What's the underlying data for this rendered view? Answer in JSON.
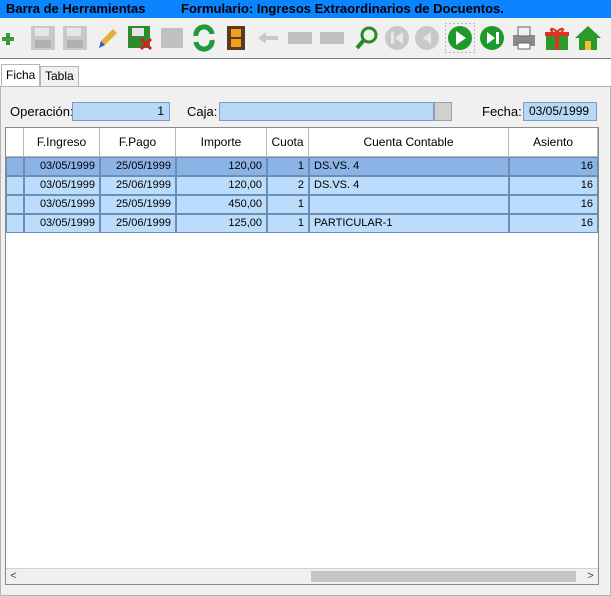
{
  "title": {
    "toolbar_label": "Barra de Herramientas",
    "form_label": "Formulario: Ingresos Extraordinarios de Docuentos."
  },
  "toolbar": {
    "buttons": [
      "add-icon",
      "save-icon",
      "save-as-icon",
      "edit-icon",
      "save-delete-icon",
      "undo-icon",
      "refresh-icon",
      "film-icon",
      "back-arrow-icon",
      "minus-icon",
      "equal-icon",
      "search-icon",
      "first-icon",
      "prev-icon",
      "next-icon",
      "last-icon",
      "print-icon",
      "gift-icon",
      "home-icon"
    ]
  },
  "tabs": [
    {
      "label": "Ficha",
      "active": true
    },
    {
      "label": "Tabla",
      "active": false
    }
  ],
  "form": {
    "operacion_label": "Operación:",
    "operacion_value": "1",
    "caja_label": "Caja:",
    "caja_value": "",
    "fecha_label": "Fecha:",
    "fecha_value": "03/05/1999"
  },
  "table": {
    "columns": [
      "F.Ingreso",
      "F.Pago",
      "Importe",
      "Cuota",
      "Cuenta Contable",
      "Asiento"
    ],
    "rows": [
      {
        "f_ingreso": "03/05/1999",
        "f_pago": "25/05/1999",
        "importe": "120,00",
        "cuota": "1",
        "cuenta": "DS.VS. 4",
        "asiento": "16"
      },
      {
        "f_ingreso": "03/05/1999",
        "f_pago": "25/06/1999",
        "importe": "120,00",
        "cuota": "2",
        "cuenta": "DS.VS. 4",
        "asiento": "16"
      },
      {
        "f_ingreso": "03/05/1999",
        "f_pago": "25/05/1999",
        "importe": "450,00",
        "cuota": "1",
        "cuenta": "",
        "asiento": "16"
      },
      {
        "f_ingreso": "03/05/1999",
        "f_pago": "25/06/1999",
        "importe": "125,00",
        "cuota": "1",
        "cuenta": "PARTICULAR-1",
        "asiento": "16"
      }
    ]
  },
  "scrollbar": {
    "left_arrow": "<",
    "right_arrow": ">"
  },
  "colors": {
    "titlebar": "#0a84ff",
    "field": "#b8d8f6",
    "row": "#bcdcfb",
    "row_selected": "#8bb3e6"
  }
}
